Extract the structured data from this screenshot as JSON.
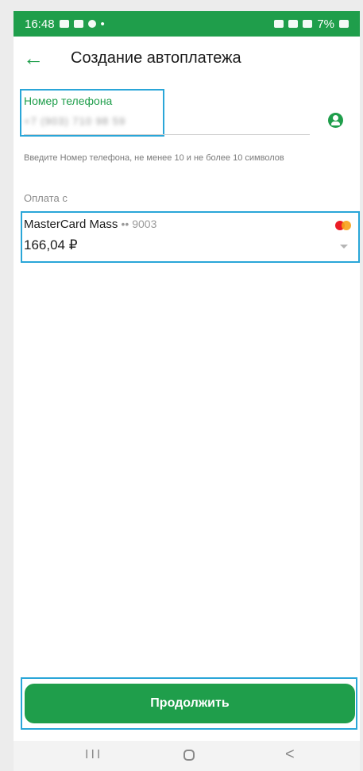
{
  "status_bar": {
    "time": "16:48",
    "right_text": "7%"
  },
  "app_bar": {
    "back_icon": "←",
    "title": "Создание автоплатежа"
  },
  "phone_field": {
    "label": "Номер телефона",
    "value": "+7 (903) 710 98 59",
    "value_blurred": true,
    "hint": "Введите Номер телефона, не менее 10 и не более 10 символов",
    "contact_icon": "contact-person-icon"
  },
  "payment": {
    "label": "Оплата с",
    "card_name": "MasterCard Mass",
    "card_number": "•• 9003",
    "amount": "166,04 ₽",
    "card_icon": "mastercard-icon"
  },
  "continue_button": {
    "label": "Продолжить"
  },
  "nav_bar": {
    "recents": "III",
    "back": "<"
  },
  "colors": {
    "accent": "#1f9e4b",
    "highlight": "#2aa6d8"
  }
}
